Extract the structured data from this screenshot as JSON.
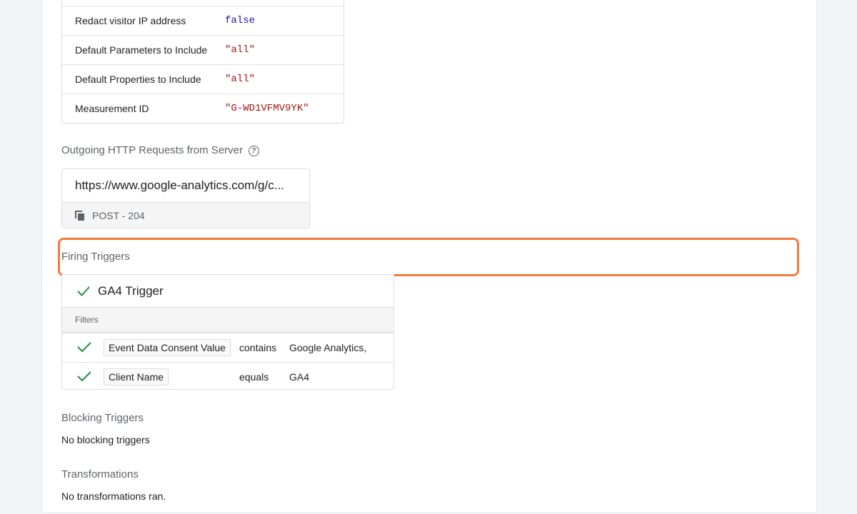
{
  "tag_properties": [
    {
      "key": "Redact visitor IP address",
      "value": "false",
      "kind": "bool"
    },
    {
      "key": "Default Parameters to Include",
      "value": "\"all\"",
      "kind": "string"
    },
    {
      "key": "Default Properties to Include",
      "value": "\"all\"",
      "kind": "string"
    },
    {
      "key": "Measurement ID",
      "value": "\"G-WD1VFMV9YK\"",
      "kind": "string"
    }
  ],
  "outgoing_requests": {
    "title": "Outgoing HTTP Requests from Server",
    "help_icon": "help-circle-icon",
    "request": {
      "url": "https://www.google-analytics.com/g/c...",
      "status": "POST - 204",
      "icon": "copy-icon"
    }
  },
  "firing_triggers": {
    "title": "Firing Triggers",
    "highlight_color": "#f47a3a",
    "trigger": {
      "name": "GA4 Trigger",
      "status_icon": "check-icon",
      "filters_label": "Filters",
      "filters": [
        {
          "variable": "Event Data Consent Value",
          "operator": "contains",
          "value": "Google Analytics,"
        },
        {
          "variable": "Client Name",
          "operator": "equals",
          "value": "GA4"
        }
      ]
    }
  },
  "blocking_triggers": {
    "title": "Blocking Triggers",
    "text": "No blocking triggers"
  },
  "transformations": {
    "title": "Transformations",
    "text": "No transformations ran."
  },
  "colors": {
    "check": "#1e8e3e",
    "string_value": "#a31515",
    "bool_value": "#1a1aa6"
  }
}
